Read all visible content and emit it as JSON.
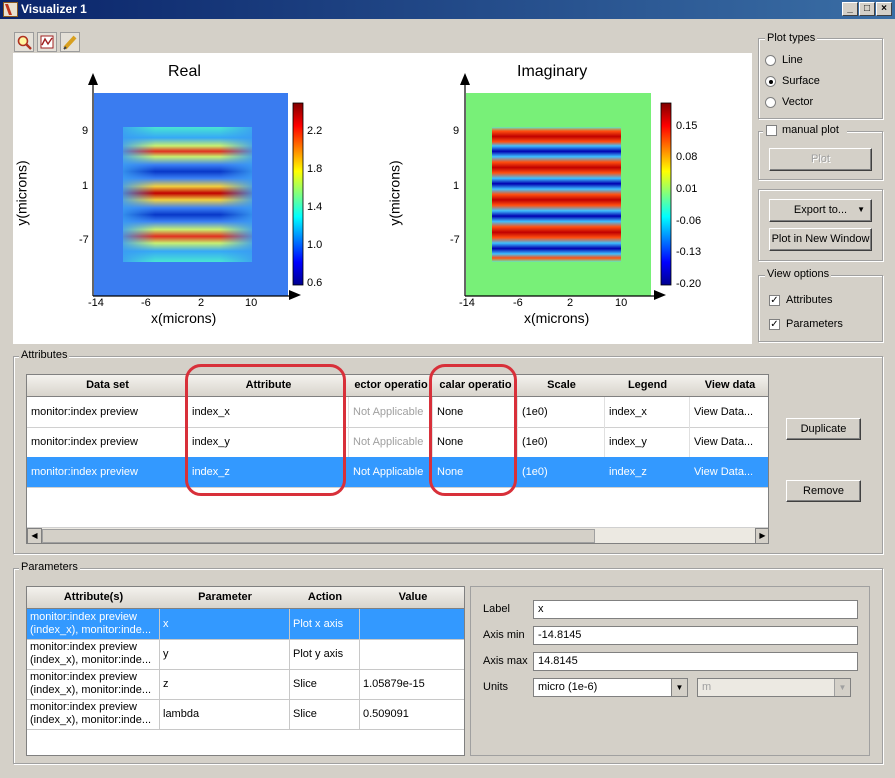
{
  "window": {
    "title": "Visualizer 1"
  },
  "toolbar": {
    "icons": [
      "zoom-icon",
      "chart-icon",
      "pencil-icon"
    ]
  },
  "plots": [
    {
      "title": "Real",
      "ylabel": "y(microns)",
      "xlabel": "x(microns)",
      "yticks": [
        "9",
        "1",
        "-7"
      ],
      "xticks": [
        "-14",
        "-6",
        "2",
        "10"
      ],
      "colorbar_ticks": [
        "2.2",
        "1.8",
        "1.4",
        "1.0",
        "0.6"
      ]
    },
    {
      "title": "Imaginary",
      "ylabel": "y(microns)",
      "xlabel": "x(microns)",
      "yticks": [
        "9",
        "1",
        "-7"
      ],
      "xticks": [
        "-14",
        "-6",
        "2",
        "10"
      ],
      "colorbar_ticks": [
        "0.15",
        "0.08",
        "0.01",
        "-0.06",
        "-0.13",
        "-0.20"
      ]
    }
  ],
  "plot_types": {
    "legend": "Plot types",
    "options": [
      "Line",
      "Surface",
      "Vector"
    ],
    "selected": "Surface"
  },
  "manual_plot": {
    "label": "manual plot",
    "checked": false,
    "plot_button": "Plot"
  },
  "export": {
    "export_button": "Export to...",
    "new_window_button": "Plot in New Window"
  },
  "view_options": {
    "legend": "View options",
    "attributes_label": "Attributes",
    "attributes_checked": true,
    "parameters_label": "Parameters",
    "parameters_checked": true
  },
  "attributes": {
    "legend": "Attributes",
    "columns": [
      "Data set",
      "Attribute",
      "ector operatio",
      "calar operatio",
      "Scale",
      "Legend",
      "View data"
    ],
    "rows": [
      {
        "dataset": "monitor:index preview",
        "attribute": "index_x",
        "vector": "Not Applicable",
        "scalar": "None",
        "scale": "(1e0)",
        "legend": "index_x",
        "view": "View Data...",
        "selected": false
      },
      {
        "dataset": "monitor:index preview",
        "attribute": "index_y",
        "vector": "Not Applicable",
        "scalar": "None",
        "scale": "(1e0)",
        "legend": "index_y",
        "view": "View Data...",
        "selected": false
      },
      {
        "dataset": "monitor:index preview",
        "attribute": "index_z",
        "vector": "Not Applicable",
        "scalar": "None",
        "scale": "(1e0)",
        "legend": "index_z",
        "view": "View Data...",
        "selected": true
      }
    ],
    "duplicate_button": "Duplicate",
    "remove_button": "Remove"
  },
  "parameters": {
    "legend": "Parameters",
    "columns": [
      "Attribute(s)",
      "Parameter",
      "Action",
      "Value"
    ],
    "rows": [
      {
        "attr1": "monitor:index preview",
        "attr2": "(index_x), monitor:inde...",
        "param": "x",
        "action": "Plot x axis",
        "value": "",
        "selected": true
      },
      {
        "attr1": "monitor:index preview",
        "attr2": "(index_x), monitor:inde...",
        "param": "y",
        "action": "Plot y axis",
        "value": "",
        "selected": false
      },
      {
        "attr1": "monitor:index preview",
        "attr2": "(index_x), monitor:inde...",
        "param": "z",
        "action": "Slice",
        "value": "1.05879e-15",
        "selected": false
      },
      {
        "attr1": "monitor:index preview",
        "attr2": "(index_x), monitor:inde...",
        "param": "lambda",
        "action": "Slice",
        "value": "0.509091",
        "selected": false
      }
    ],
    "form": {
      "label_label": "Label",
      "label_value": "x",
      "axis_min_label": "Axis min",
      "axis_min_value": "-14.8145",
      "axis_max_label": "Axis max",
      "axis_max_value": "14.8145",
      "units_label": "Units",
      "units_value": "micro (1e-6)",
      "units_second": "m"
    }
  },
  "colors": {
    "selection": "#3399ff",
    "highlight_box": "#d8303a",
    "panel": "#d4d0c8"
  }
}
